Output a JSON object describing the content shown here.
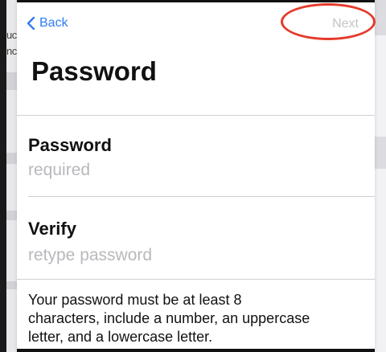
{
  "nav": {
    "back_label": "Back",
    "next_label": "Next"
  },
  "page": {
    "title": "Password"
  },
  "fields": {
    "password": {
      "label": "Password",
      "placeholder": "required",
      "value": ""
    },
    "verify": {
      "label": "Verify",
      "placeholder": "retype password",
      "value": ""
    }
  },
  "hint": {
    "lines": [
      "Your password must be at least 8",
      "characters, include a number, an uppercase",
      "letter, and a lowercase letter."
    ]
  },
  "background_peek": {
    "line1": "uc",
    "line2": "nc"
  },
  "colors": {
    "accent": "#2f7cf6",
    "disabled_text": "#c4c4c8",
    "annotation_circle": "#e53a2a",
    "placeholder": "#b8b8bd"
  }
}
